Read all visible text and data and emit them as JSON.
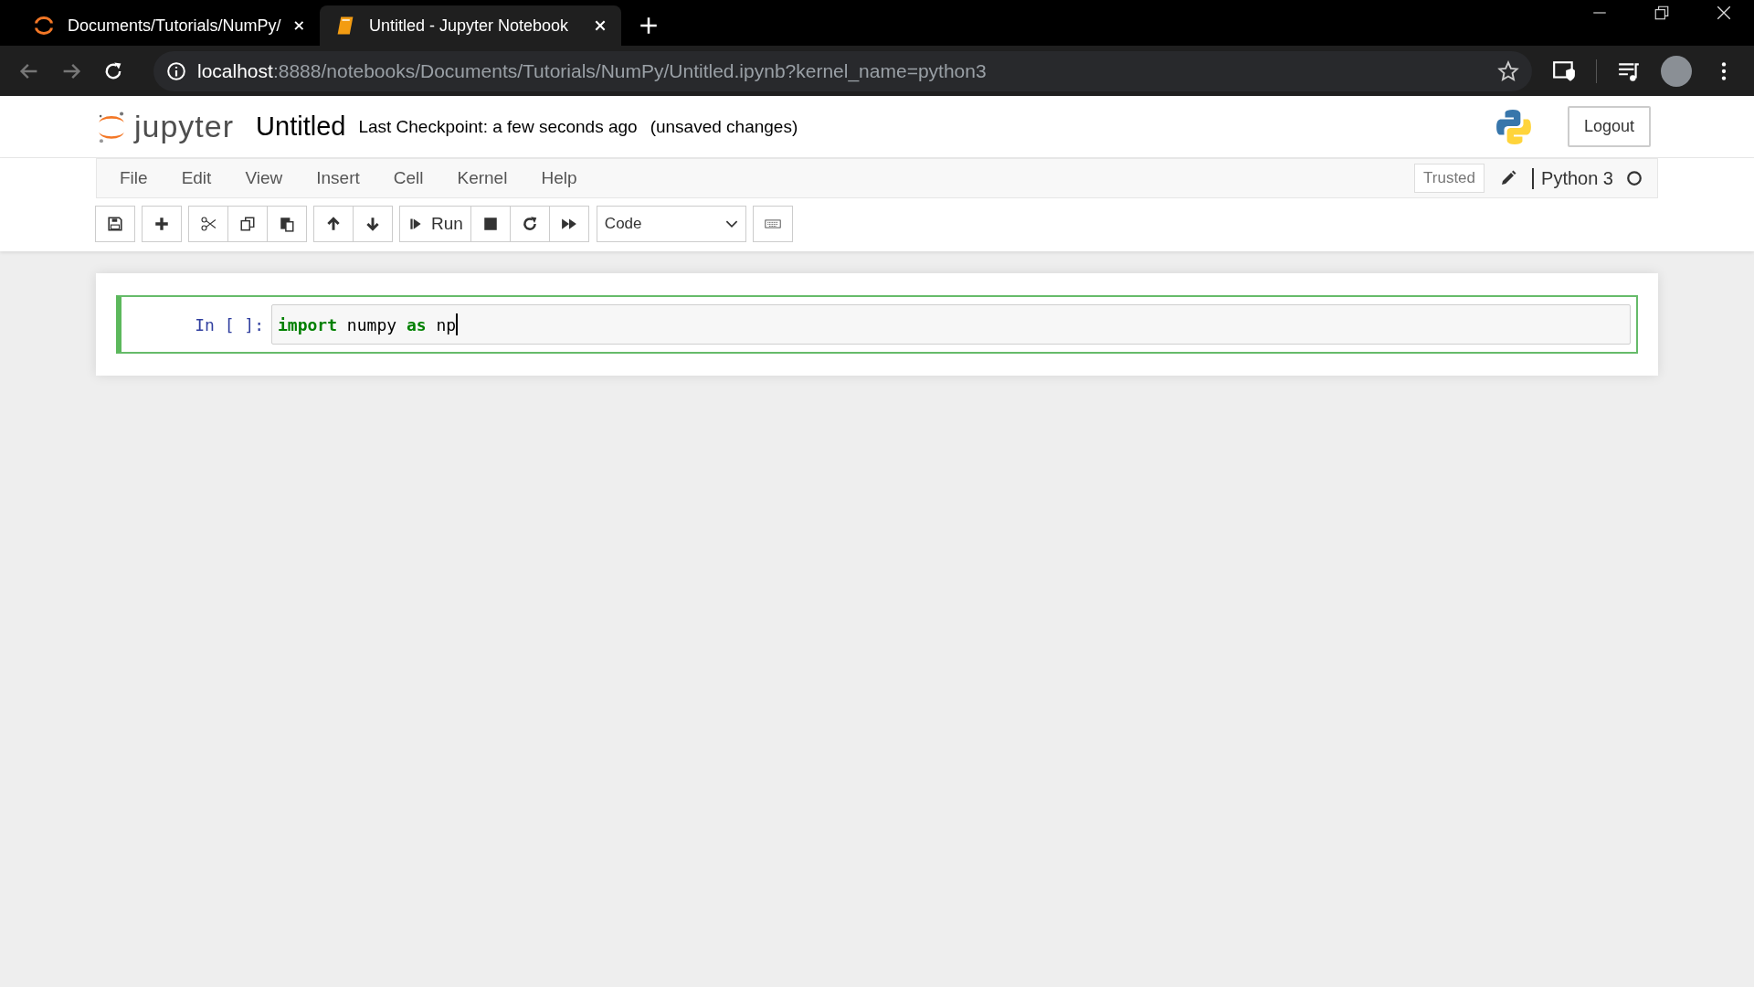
{
  "browser": {
    "tabs": [
      {
        "title": "Documents/Tutorials/NumPy/",
        "selected": false,
        "kind": "jupyter"
      },
      {
        "title": "Untitled - Jupyter Notebook",
        "selected": true,
        "kind": "notebook"
      }
    ],
    "address": {
      "host": "localhost",
      "path": ":8888/notebooks/Documents/Tutorials/NumPy/Untitled.ipynb?kernel_name=python3"
    }
  },
  "header": {
    "logo_text": "jupyter",
    "notebook_name": "Untitled",
    "checkpoint": "Last Checkpoint: a few seconds ago",
    "autosave_status": "(unsaved changes)",
    "logout": "Logout"
  },
  "menu": [
    "File",
    "Edit",
    "View",
    "Insert",
    "Cell",
    "Kernel",
    "Help"
  ],
  "status": {
    "trusted": "Trusted",
    "kernel": "Python 3"
  },
  "toolbar": {
    "run_label": "Run",
    "cell_type": "Code"
  },
  "cell": {
    "prompt": "In [ ]:",
    "tokens": [
      {
        "kind": "keyword",
        "text": "import"
      },
      {
        "kind": "name",
        "text": " numpy "
      },
      {
        "kind": "keyword",
        "text": "as"
      },
      {
        "kind": "name",
        "text": " np"
      }
    ]
  }
}
